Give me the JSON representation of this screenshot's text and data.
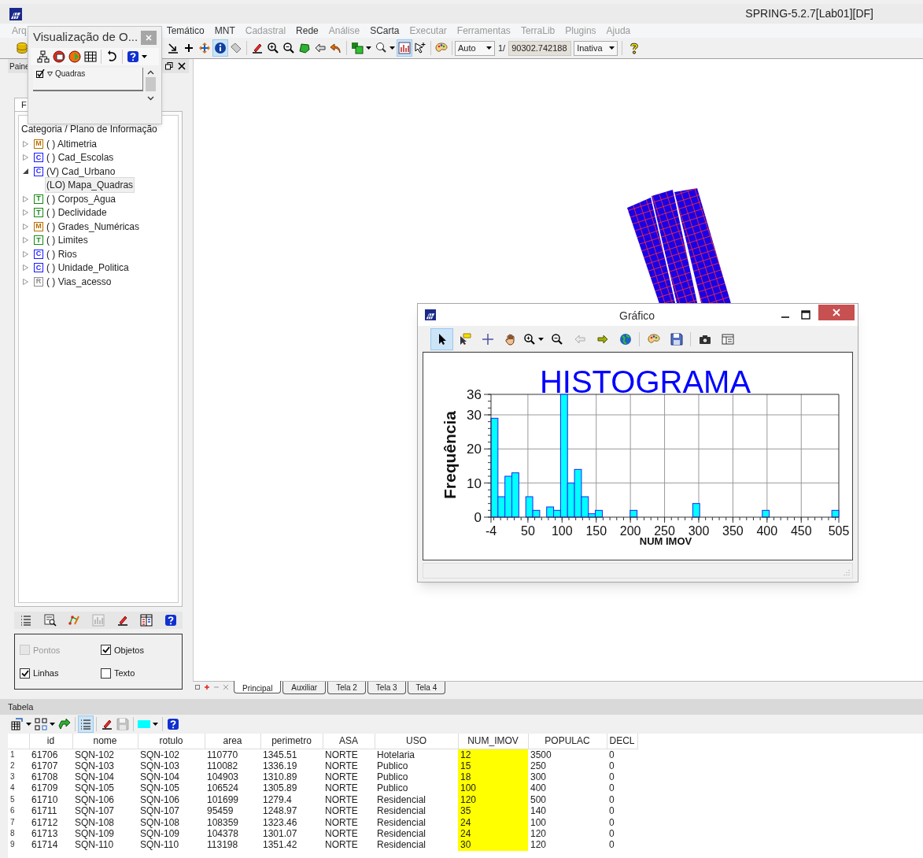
{
  "window": {
    "title": "SPRING-5.2.7[Lab01][DF]"
  },
  "menu": [
    {
      "label": "Arq",
      "disabled": true
    },
    {
      "label": "Temático",
      "disabled": false
    },
    {
      "label": "MNT",
      "disabled": false
    },
    {
      "label": "Cadastral",
      "disabled": true
    },
    {
      "label": "Rede",
      "disabled": false
    },
    {
      "label": "Análise",
      "disabled": true
    },
    {
      "label": "SCarta",
      "disabled": false
    },
    {
      "label": "Executar",
      "disabled": true
    },
    {
      "label": "Ferramentas",
      "disabled": true
    },
    {
      "label": "TerraLib",
      "disabled": true
    },
    {
      "label": "Plugins",
      "disabled": true
    },
    {
      "label": "Ajuda",
      "disabled": true
    }
  ],
  "toolbar": {
    "groups": [
      [
        {
          "kind": "database",
          "pressed": false,
          "disabled": false
        }
      ],
      [
        {
          "kind": "corner-arrow",
          "pressed": false,
          "disabled": false
        },
        {
          "kind": "plus",
          "pressed": false,
          "disabled": false
        },
        {
          "kind": "move",
          "pressed": false,
          "disabled": false
        },
        {
          "kind": "info",
          "pressed": true,
          "disabled": false
        },
        {
          "kind": "tag",
          "pressed": false,
          "disabled": false
        }
      ],
      [
        {
          "kind": "pencil",
          "pressed": false,
          "disabled": false
        },
        {
          "kind": "zoom-in",
          "pressed": false,
          "disabled": false
        },
        {
          "kind": "zoom-out",
          "pressed": false,
          "disabled": false
        },
        {
          "kind": "polygon",
          "pressed": false,
          "disabled": false
        },
        {
          "kind": "back",
          "pressed": false,
          "disabled": false
        },
        {
          "kind": "undo",
          "pressed": false,
          "disabled": false
        }
      ],
      [
        {
          "kind": "layers",
          "pressed": false,
          "disabled": false,
          "dropdown": true
        },
        {
          "kind": "label-zoom",
          "pressed": false,
          "disabled": false,
          "dropdown": true
        },
        {
          "kind": "histogram",
          "pressed": true,
          "disabled": false
        },
        {
          "kind": "cursor-plus",
          "pressed": false,
          "disabled": false
        }
      ],
      [
        {
          "kind": "palette",
          "pressed": false,
          "disabled": false
        }
      ]
    ],
    "scale_mode": "Auto",
    "scale_prefix": "1/",
    "scale_value": "90302.742188",
    "pointer_mode": "Inativa",
    "help": [
      {
        "kind": "help-yellow",
        "pressed": false,
        "disabled": false
      }
    ]
  },
  "overlay_window": {
    "title": "Visualização de O...",
    "toolbar": [
      [
        {
          "kind": "tree",
          "pressed": false,
          "disabled": false
        },
        {
          "kind": "layer-red",
          "pressed": false,
          "disabled": false
        },
        {
          "kind": "layer-orange",
          "pressed": false,
          "disabled": false
        },
        {
          "kind": "table",
          "pressed": false,
          "disabled": false
        }
      ],
      [
        {
          "kind": "rotate",
          "pressed": false,
          "disabled": false
        }
      ],
      [
        {
          "kind": "help-blue",
          "pressed": false,
          "disabled": false,
          "dropdown": true
        }
      ]
    ],
    "layers": [
      {
        "label": "Quadras",
        "checked": true
      }
    ]
  },
  "panel": {
    "title": "Paine",
    "tabs": [
      {
        "label": "F",
        "selected": true
      }
    ],
    "group_label": "Categoria / Plano de Informação",
    "tree": [
      {
        "label": "( ) Altimetria",
        "badge": "M",
        "color": "#b86e00",
        "expanded": false
      },
      {
        "label": "( ) Cad_Escolas",
        "badge": "C",
        "color": "#1a1aff",
        "expanded": false
      },
      {
        "label": "(V) Cad_Urbano",
        "badge": "C",
        "color": "#1a1aff",
        "expanded": true,
        "children": [
          {
            "label": "(LO) Mapa_Quadras",
            "selected": true
          }
        ]
      },
      {
        "label": "( ) Corpos_Agua",
        "badge": "T",
        "color": "#138a13",
        "expanded": false
      },
      {
        "label": "( ) Declividade",
        "badge": "T",
        "color": "#138a13",
        "expanded": false
      },
      {
        "label": "( ) Grades_Numéricas",
        "badge": "M",
        "color": "#b86e00",
        "expanded": false
      },
      {
        "label": "( ) Limites",
        "badge": "T",
        "color": "#138a13",
        "expanded": false
      },
      {
        "label": "( ) Rios",
        "badge": "C",
        "color": "#1a1aff",
        "expanded": false
      },
      {
        "label": "( ) Unidade_Politica",
        "badge": "C",
        "color": "#1a1aff",
        "expanded": false
      },
      {
        "label": "( ) Vias_acesso",
        "badge": "R",
        "color": "#8c8c8c",
        "expanded": false
      }
    ],
    "tools": [
      [
        {
          "kind": "list",
          "pressed": false,
          "disabled": false
        },
        {
          "kind": "find",
          "pressed": false,
          "disabled": false
        },
        {
          "kind": "vertex",
          "pressed": false,
          "disabled": false
        },
        {
          "kind": "histogram",
          "pressed": false,
          "disabled": true
        },
        {
          "kind": "pencil",
          "pressed": false,
          "disabled": false
        },
        {
          "kind": "legend",
          "pressed": false,
          "disabled": false
        },
        {
          "kind": "help-blue",
          "pressed": false,
          "disabled": false
        }
      ]
    ],
    "options": [
      {
        "label": "Pontos",
        "checked": false,
        "disabled": true
      },
      {
        "label": "Objetos",
        "checked": true,
        "disabled": false
      },
      {
        "label": "Linhas",
        "checked": true,
        "disabled": false
      },
      {
        "label": "Texto",
        "checked": false,
        "disabled": false
      }
    ]
  },
  "canvas": {
    "tabs": [
      {
        "label": "Principal",
        "selected": true
      },
      {
        "label": "Auxiliar",
        "selected": false
      },
      {
        "label": "Tela 2",
        "selected": false
      },
      {
        "label": "Tela 3",
        "selected": false
      },
      {
        "label": "Tela 4",
        "selected": false
      }
    ]
  },
  "chart_window": {
    "title": "Gráfico",
    "toolbar": [
      [
        {
          "kind": "pointer",
          "pressed": true,
          "disabled": false
        },
        {
          "kind": "flag",
          "pressed": false,
          "disabled": false
        },
        {
          "kind": "crosshair",
          "pressed": false,
          "disabled": false
        },
        {
          "kind": "hand",
          "pressed": false,
          "disabled": false
        },
        {
          "kind": "zoom-in",
          "pressed": false,
          "disabled": false,
          "dropdown": true
        },
        {
          "kind": "zoom-out",
          "pressed": false,
          "disabled": false
        },
        {
          "kind": "back",
          "pressed": false,
          "disabled": true
        },
        {
          "kind": "forward",
          "pressed": false,
          "disabled": false
        },
        {
          "kind": "globe",
          "pressed": false,
          "disabled": false
        }
      ],
      [
        {
          "kind": "palette",
          "pressed": false,
          "disabled": false
        },
        {
          "kind": "save",
          "pressed": false,
          "disabled": false
        }
      ],
      [
        {
          "kind": "camera",
          "pressed": false,
          "disabled": false
        },
        {
          "kind": "panel",
          "pressed": false,
          "disabled": false
        }
      ]
    ],
    "chart_data": {
      "type": "bar",
      "title": "HISTOGRAMA",
      "xlabel": "NUM IMOV",
      "ylabel": "Frequência",
      "x": [
        1.09,
        11.27,
        21.45,
        31.63,
        51.99,
        62.17,
        82.53,
        92.71,
        102.89,
        113.07,
        123.25,
        133.43,
        143.61,
        153.79,
        204.69,
        296.31,
        398.11,
        499.91
      ],
      "series": [
        {
          "color": "#00ffff",
          "values": [
            29,
            6,
            12,
            13,
            6,
            2,
            3,
            2,
            36,
            10,
            14,
            6,
            1,
            2,
            2,
            4,
            2,
            2
          ]
        }
      ],
      "xlim": [
        -4,
        505
      ],
      "ylim": [
        0,
        36
      ],
      "xticks": [
        -4,
        50,
        100,
        150,
        200,
        250,
        300,
        350,
        400,
        450,
        505
      ],
      "yticks": [
        0,
        10,
        20,
        30,
        36
      ],
      "grid": true
    }
  },
  "table": {
    "title": "Tabela",
    "toolbar": [
      [
        {
          "kind": "table-swap",
          "pressed": false,
          "disabled": false,
          "dropdown": true
        },
        {
          "kind": "nodes",
          "pressed": false,
          "disabled": false,
          "dropdown": true
        },
        {
          "kind": "arrow-green",
          "pressed": false,
          "disabled": false
        }
      ],
      [
        {
          "kind": "list",
          "pressed": true,
          "disabled": false
        }
      ],
      [
        {
          "kind": "pencil",
          "pressed": false,
          "disabled": false
        },
        {
          "kind": "save",
          "pressed": false,
          "disabled": true
        }
      ],
      [
        {
          "kind": "swatch",
          "pressed": false,
          "disabled": false,
          "dropdown": true
        }
      ],
      [
        {
          "kind": "help-blue",
          "pressed": false,
          "disabled": false
        }
      ]
    ],
    "columns": [
      {
        "label": "id",
        "selected": false
      },
      {
        "label": "nome",
        "selected": false
      },
      {
        "label": "rotulo",
        "selected": false
      },
      {
        "label": "area",
        "selected": false
      },
      {
        "label": "perimetro",
        "selected": false
      },
      {
        "label": "ASA",
        "selected": false
      },
      {
        "label": "USO",
        "selected": false
      },
      {
        "label": "NUM_IMOV",
        "selected": true
      },
      {
        "label": "POPULAC",
        "selected": false
      },
      {
        "label": "DECL",
        "selected": false
      }
    ],
    "rows": [
      {
        "number": "1",
        "cells": [
          "61706",
          "SQN-102",
          "SQN-102",
          "110770",
          "1345.51",
          "NORTE",
          "Hotelaria",
          "12",
          "3500",
          "0"
        ]
      },
      {
        "number": "2",
        "cells": [
          "61707",
          "SQN-103",
          "SQN-103",
          "110082",
          "1336.19",
          "NORTE",
          "Publico",
          "15",
          "250",
          "0"
        ]
      },
      {
        "number": "3",
        "cells": [
          "61708",
          "SQN-104",
          "SQN-104",
          "104903",
          "1310.89",
          "NORTE",
          "Publico",
          "18",
          "300",
          "0"
        ]
      },
      {
        "number": "4",
        "cells": [
          "61709",
          "SQN-105",
          "SQN-105",
          "106524",
          "1305.89",
          "NORTE",
          "Publico",
          "100",
          "400",
          "0"
        ]
      },
      {
        "number": "5",
        "cells": [
          "61710",
          "SQN-106",
          "SQN-106",
          "101699",
          "1279.4",
          "NORTE",
          "Residencial",
          "120",
          "500",
          "0"
        ]
      },
      {
        "number": "6",
        "cells": [
          "61711",
          "SQN-107",
          "SQN-107",
          "95459",
          "1248.97",
          "NORTE",
          "Residencial",
          "35",
          "140",
          "0"
        ]
      },
      {
        "number": "7",
        "cells": [
          "61712",
          "SQN-108",
          "SQN-108",
          "108359",
          "1323.46",
          "NORTE",
          "Residencial",
          "24",
          "100",
          "0"
        ]
      },
      {
        "number": "8",
        "cells": [
          "61713",
          "SQN-109",
          "SQN-109",
          "104378",
          "1301.07",
          "NORTE",
          "Residencial",
          "24",
          "120",
          "0"
        ]
      },
      {
        "number": "9",
        "cells": [
          "61714",
          "SQN-110",
          "SQN-110",
          "113198",
          "1351.42",
          "NORTE",
          "Residencial",
          "30",
          "120",
          "0"
        ]
      }
    ]
  }
}
